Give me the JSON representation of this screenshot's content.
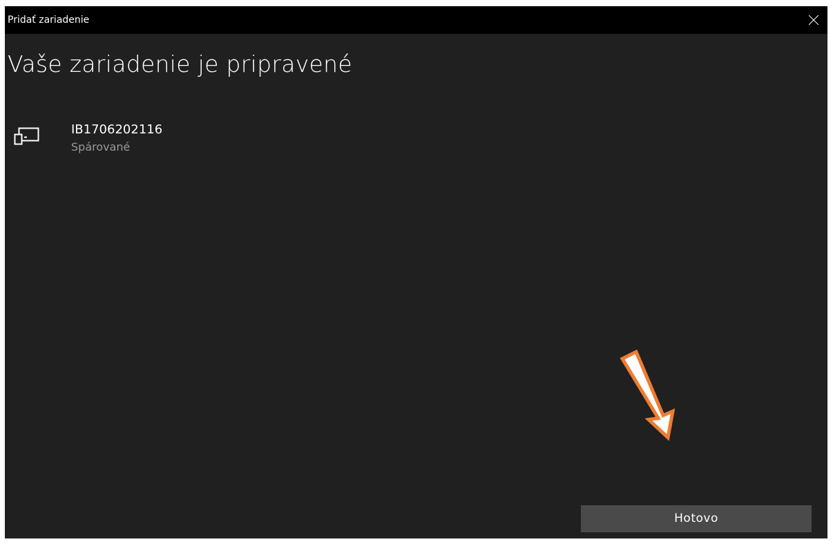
{
  "window": {
    "title": "Pridať zariadenie"
  },
  "main": {
    "heading": "Vaše zariadenie je pripravené",
    "device": {
      "name": "IB1706202116",
      "status": "Spárované",
      "icon": "devices-icon"
    },
    "done_label": "Hotovo"
  },
  "annotation": {
    "icon": "arrow-down-right-icon",
    "color": "#ED7D31"
  },
  "colors": {
    "titlebar_bg": "#000000",
    "window_bg": "#202020",
    "button_bg": "#4A4A4A",
    "secondary_text": "#9A9A9A"
  }
}
